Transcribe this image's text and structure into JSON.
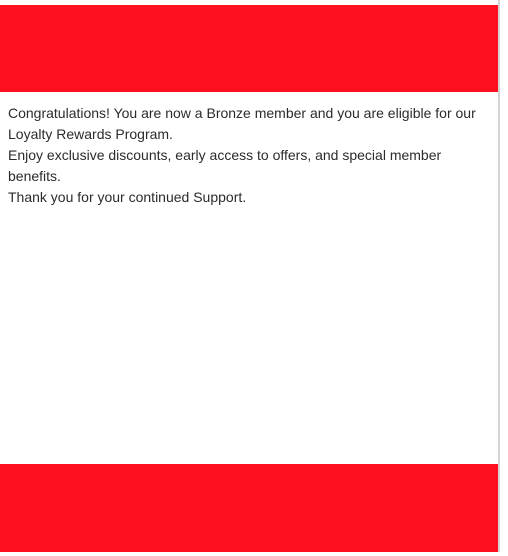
{
  "colors": {
    "band_red": "#ff0f1f",
    "text": "#2b2b2b",
    "background": "#ffffff"
  },
  "message": {
    "lines": [
      "Congratulations! You are now a Bronze member and you are eligible for our Loyalty Rewards Program.",
      "Enjoy exclusive discounts, early access to offers, and special member benefits.",
      "Thank you for your continued Support."
    ]
  }
}
